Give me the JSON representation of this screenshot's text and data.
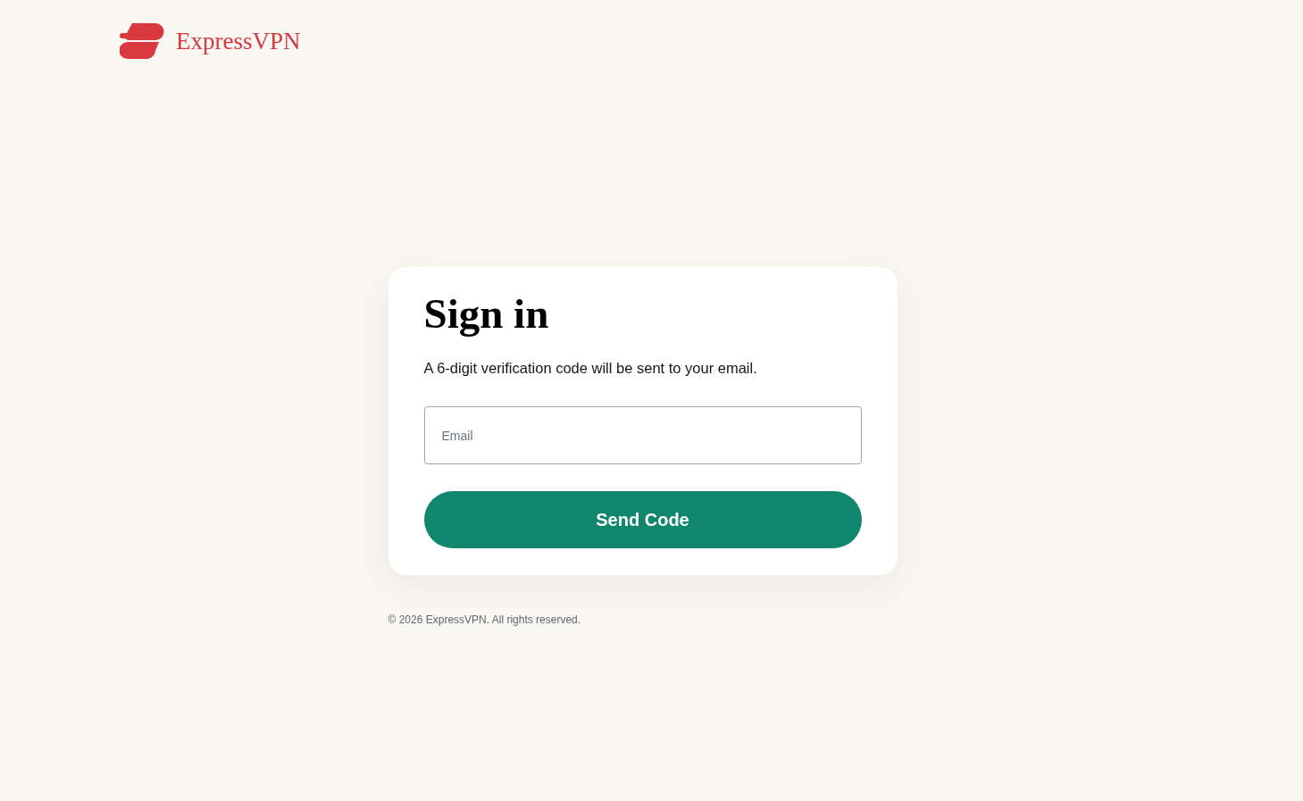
{
  "header": {
    "logo_text": "ExpressVPN"
  },
  "card": {
    "title": "Sign in",
    "subtitle": "A 6-digit verification code will be sent to your email.",
    "email_field": {
      "placeholder": "Email"
    },
    "submit_button": {
      "label": "Send Code"
    }
  },
  "footer": {
    "copyright": "© 2026 ExpressVPN. All rights reserved."
  }
}
